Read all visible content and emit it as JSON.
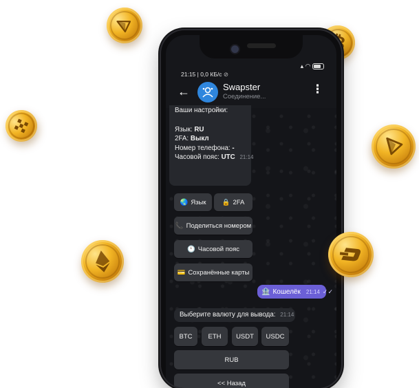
{
  "status_bar": {
    "time_data": "21:15 | 0,0 КБ/с",
    "icons": [
      "mute-icon",
      "signal-icon",
      "wifi-icon",
      "battery-icon"
    ]
  },
  "chat": {
    "title": "Swapster",
    "subtitle": "Соединение..."
  },
  "settings_message": {
    "heading": "Ваши настройки:",
    "lines": [
      {
        "key": "Язык:",
        "value": "RU"
      },
      {
        "key": "2FA:",
        "value": "Выкл"
      },
      {
        "key": "Номер телефона:",
        "value": "-"
      },
      {
        "key": "Часовой пояс:",
        "value": "UTC"
      }
    ],
    "time": "21:14"
  },
  "settings_keyboard": {
    "language": {
      "icon": "globe-icon",
      "label": "Язык"
    },
    "twofa": {
      "icon": "lock-icon",
      "label": "2FA"
    },
    "share_phone": {
      "icon": "phone-icon",
      "label": "Поделиться номером"
    },
    "timezone": {
      "icon": "clock-icon",
      "label": "Часовой пояс"
    },
    "saved_cards": {
      "icon": "card-icon",
      "label": "Сохранённые карты"
    }
  },
  "outgoing_message": {
    "icon": "bank-icon",
    "text": "Кошелёк",
    "time": "21:14",
    "status_icon": "double-check-icon"
  },
  "currency_message": {
    "text": "Выберите валюту для вывода:",
    "time": "21:14"
  },
  "currency_keyboard": {
    "options": [
      "BTC",
      "ETH",
      "USDT",
      "USDC"
    ],
    "rub": "RUB",
    "back": "<< Назад"
  },
  "coins": [
    "tron-coin",
    "bitcoin-coin",
    "binance-coin",
    "tron-coin",
    "ethereum-coin",
    "dash-coin"
  ],
  "colors": {
    "accent_bubble": "#6b5fd6",
    "avatar": "#2f86dd",
    "coin_gold": "#f2b525"
  }
}
